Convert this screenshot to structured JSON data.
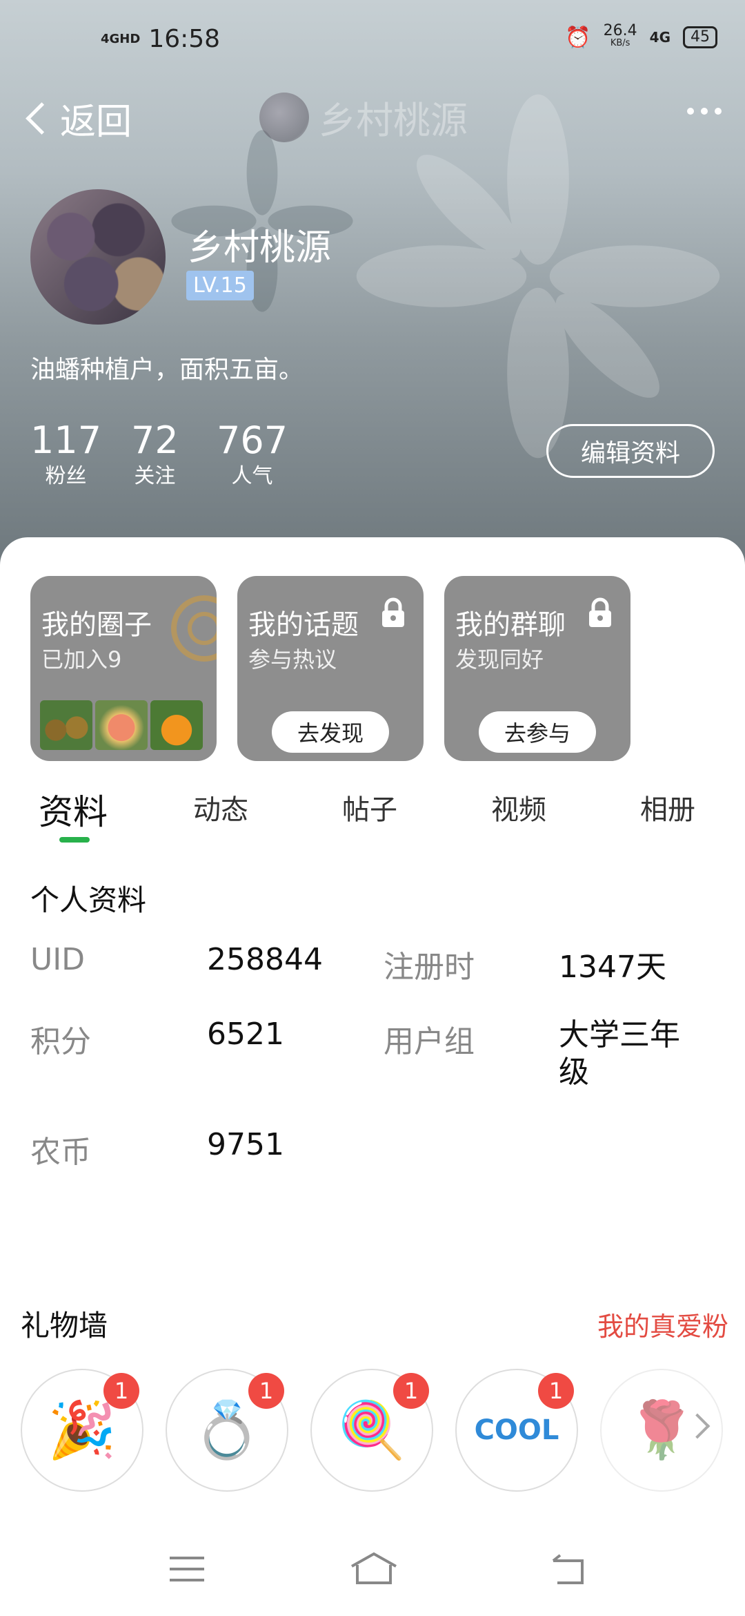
{
  "status_bar": {
    "network": "4GHD",
    "time": "16:58",
    "speed": "26.4",
    "speed_unit": "KB/s",
    "net_type": "4G",
    "battery": "45"
  },
  "navbar": {
    "back_label": "返回",
    "title": "乡村桃源"
  },
  "profile": {
    "name": "乡村桃源",
    "level": "LV.15",
    "bio": "油蟠种植户，面积五亩。",
    "stats": [
      {
        "num": "117",
        "label": "粉丝"
      },
      {
        "num": "72",
        "label": "关注"
      },
      {
        "num": "767",
        "label": "人气"
      }
    ],
    "edit_label": "编辑资料"
  },
  "cards": [
    {
      "title": "我的圈子",
      "sub": "已加入9"
    },
    {
      "title": "我的话题",
      "sub": "参与热议",
      "button": "去发现"
    },
    {
      "title": "我的群聊",
      "sub": "发现同好",
      "button": "去参与"
    }
  ],
  "tabs": [
    "资料",
    "动态",
    "帖子",
    "视频",
    "相册"
  ],
  "info": {
    "section_title": "个人资料",
    "rows": [
      {
        "k1": "UID",
        "v1": "258844",
        "k2": "注册时",
        "v2": "1347天"
      },
      {
        "k1": "积分",
        "v1": "6521",
        "k2": "用户组",
        "v2": "大学三年级"
      },
      {
        "k1": "农币",
        "v1": "9751"
      }
    ]
  },
  "gifts": {
    "title": "礼物墙",
    "link": "我的真爱粉",
    "items": [
      {
        "icon": "party-popper-icon",
        "count": "1"
      },
      {
        "icon": "diamond-ring-icon",
        "count": "1"
      },
      {
        "icon": "lollipop-icon",
        "count": "1"
      },
      {
        "icon": "cool-sticker-icon",
        "count": "1"
      },
      {
        "icon": "rose-icon"
      }
    ]
  },
  "colors": {
    "accent_green": "#28b14b",
    "link_red": "#e34b42",
    "badge_red": "#f04a43",
    "level_blue": "#9fc3ee"
  }
}
